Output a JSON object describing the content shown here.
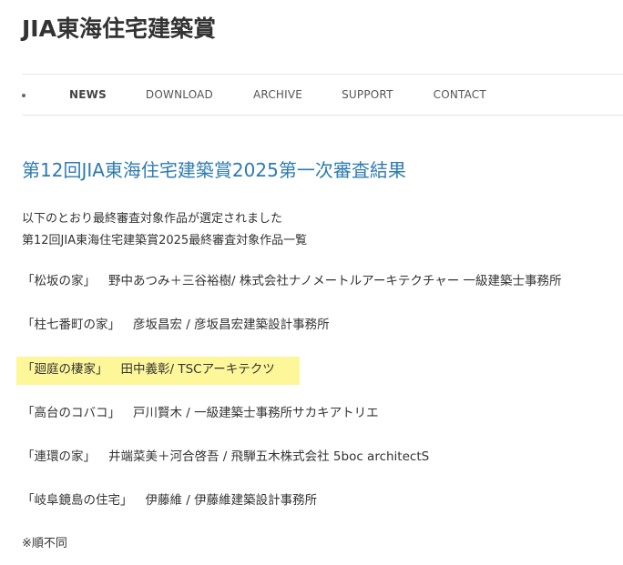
{
  "site": {
    "title": "JIA東海住宅建築賞"
  },
  "nav": {
    "items": [
      {
        "label": "NEWS",
        "active": true
      },
      {
        "label": "DOWNLOAD",
        "active": false
      },
      {
        "label": "ARCHIVE",
        "active": false
      },
      {
        "label": "SUPPORT",
        "active": false
      },
      {
        "label": "CONTACT",
        "active": false
      }
    ]
  },
  "post": {
    "title": "第12回JIA東海住宅建築賞2025第一次審査結果",
    "intro_line1": "以下のとおり最終審査対象作品が選定されました",
    "intro_line2": "第12回JIA東海住宅建築賞2025最終審査対象作品一覧",
    "entries": [
      {
        "work": "「松坂の家」",
        "credit": "野中あつみ＋三谷裕樹/ 株式会社ナノメートルアーキテクチャー 一級建築士事務所"
      },
      {
        "work": "「柱七番町の家」",
        "credit": "彦坂昌宏 / 彦坂昌宏建築設計事務所"
      },
      {
        "work": "「廻庭の棲家」",
        "credit": "田中義彰/ TSCアーキテクツ",
        "highlighted": true
      },
      {
        "work": "「高台のコバコ」",
        "credit": "戸川賢木 / 一級建築士事務所サカキアトリエ"
      },
      {
        "work": "「連環の家」",
        "credit": "井端菜美＋河合啓吾 / 飛騨五木株式会社 5boc architectS"
      },
      {
        "work": "「岐阜鏡島の住宅」",
        "credit": "伊藤維 / 伊藤維建築設計事務所"
      }
    ],
    "note": "※順不同"
  },
  "colors": {
    "title_link": "#2e7bb0",
    "highlight": "#fdf79a",
    "text": "#333333"
  }
}
